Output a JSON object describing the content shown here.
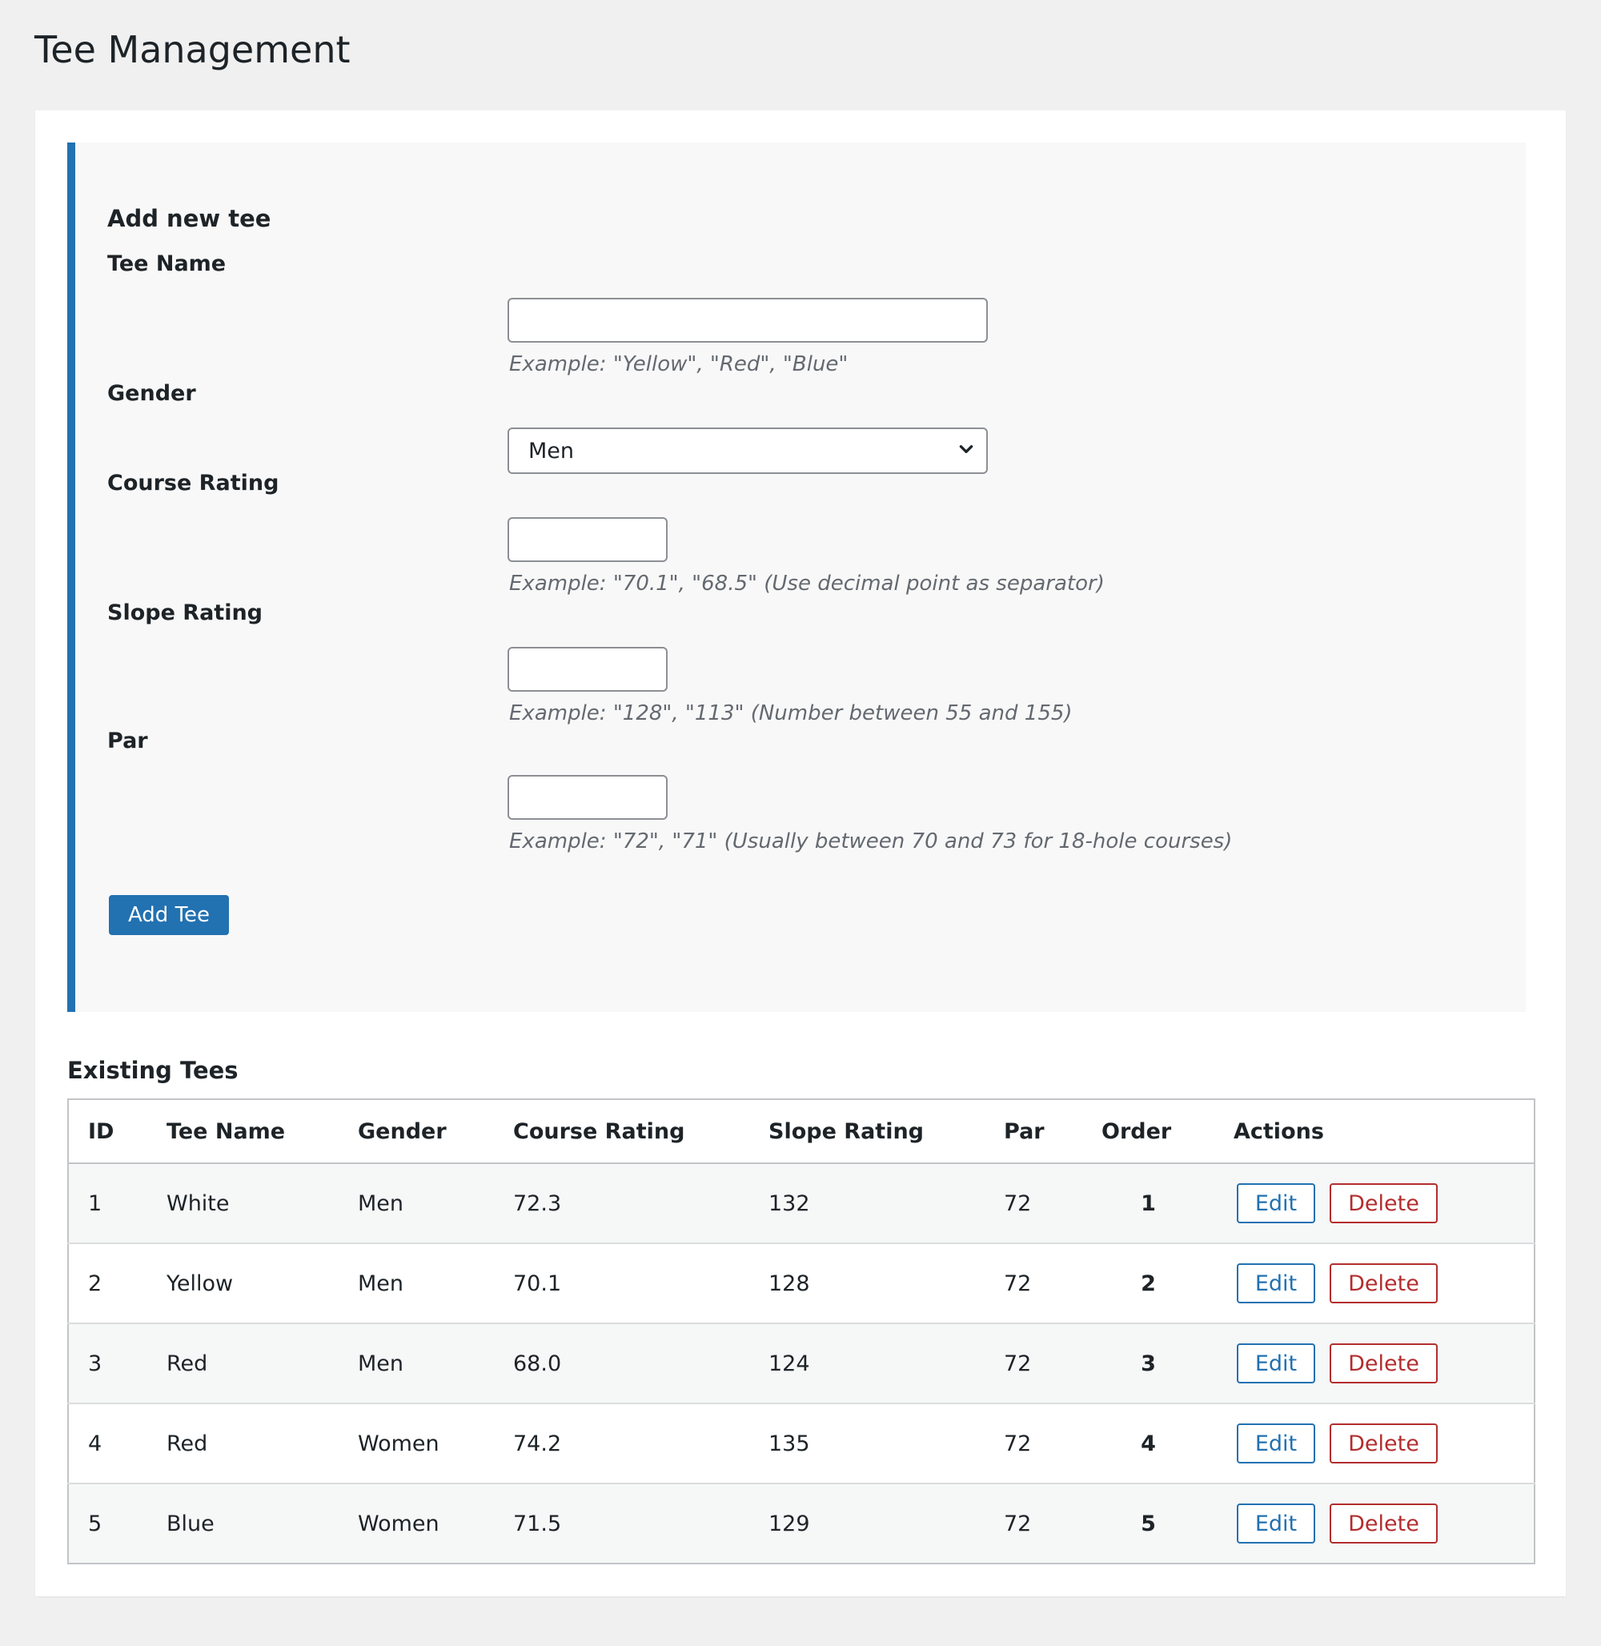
{
  "page": {
    "title": "Tee Management"
  },
  "form": {
    "heading": "Add new tee",
    "fields": {
      "tee_name": {
        "label": "Tee Name",
        "value": "",
        "hint": "Example: \"Yellow\", \"Red\", \"Blue\""
      },
      "gender": {
        "label": "Gender",
        "selected": "Men"
      },
      "course_rating": {
        "label": "Course Rating",
        "value": "",
        "hint": "Example: \"70.1\", \"68.5\" (Use decimal point as separator)"
      },
      "slope_rating": {
        "label": "Slope Rating",
        "value": "",
        "hint": "Example: \"128\", \"113\" (Number between 55 and 155)"
      },
      "par": {
        "label": "Par",
        "value": "",
        "hint": "Example: \"72\", \"71\" (Usually between 70 and 73 for 18-hole courses)"
      }
    },
    "submit_label": "Add Tee"
  },
  "existing": {
    "title": "Existing Tees",
    "columns": [
      "ID",
      "Tee Name",
      "Gender",
      "Course Rating",
      "Slope Rating",
      "Par",
      "Order",
      "Actions"
    ],
    "rows": [
      {
        "id": "1",
        "name": "White",
        "gender": "Men",
        "course_rating": "72.3",
        "slope_rating": "132",
        "par": "72",
        "order": "1"
      },
      {
        "id": "2",
        "name": "Yellow",
        "gender": "Men",
        "course_rating": "70.1",
        "slope_rating": "128",
        "par": "72",
        "order": "2"
      },
      {
        "id": "3",
        "name": "Red",
        "gender": "Men",
        "course_rating": "68.0",
        "slope_rating": "124",
        "par": "72",
        "order": "3"
      },
      {
        "id": "4",
        "name": "Red",
        "gender": "Women",
        "course_rating": "74.2",
        "slope_rating": "135",
        "par": "72",
        "order": "4"
      },
      {
        "id": "5",
        "name": "Blue",
        "gender": "Women",
        "course_rating": "71.5",
        "slope_rating": "129",
        "par": "72",
        "order": "5"
      }
    ],
    "edit_label": "Edit",
    "delete_label": "Delete"
  },
  "colors": {
    "accent": "#2271b1",
    "danger": "#b32d2e",
    "background": "#f0f0f1"
  },
  "icons": {
    "select_arrow": "chevron-down-icon"
  }
}
